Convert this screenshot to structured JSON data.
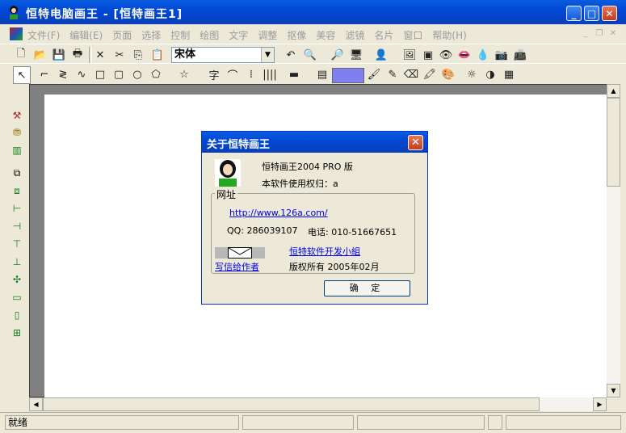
{
  "window": {
    "title": "恒特电脑画王 - [恒特画王1]",
    "minimize": "_",
    "maximize": "□",
    "close": "✕"
  },
  "menu": {
    "items": [
      "文件(F)",
      "编辑(E)",
      "页面",
      "选择",
      "控制",
      "绘图",
      "文字",
      "调整",
      "抠像",
      "美容",
      "滤镜",
      "名片",
      "窗口",
      "帮助(H)"
    ]
  },
  "toolbar": {
    "font_value": "宋体"
  },
  "statusbar": {
    "text": "就绪"
  },
  "dialog": {
    "title": "关于恒特画王",
    "product": "恒特画王2004 PRO 版",
    "license": "本软件使用权归：a",
    "group_label": "网址",
    "url": "http://www.126a.com/",
    "qq": "QQ: 286039107",
    "phone": "电话: 010-51667651",
    "dev_team": "恒特软件开发小組",
    "write_author": "写信给作者",
    "copyright": "版权所有 2005年02月",
    "ok": "确 定"
  },
  "colors": {
    "accent": "#0a5ce0",
    "canvas_bg": "#808080",
    "current_color": "#7f7ff0"
  }
}
